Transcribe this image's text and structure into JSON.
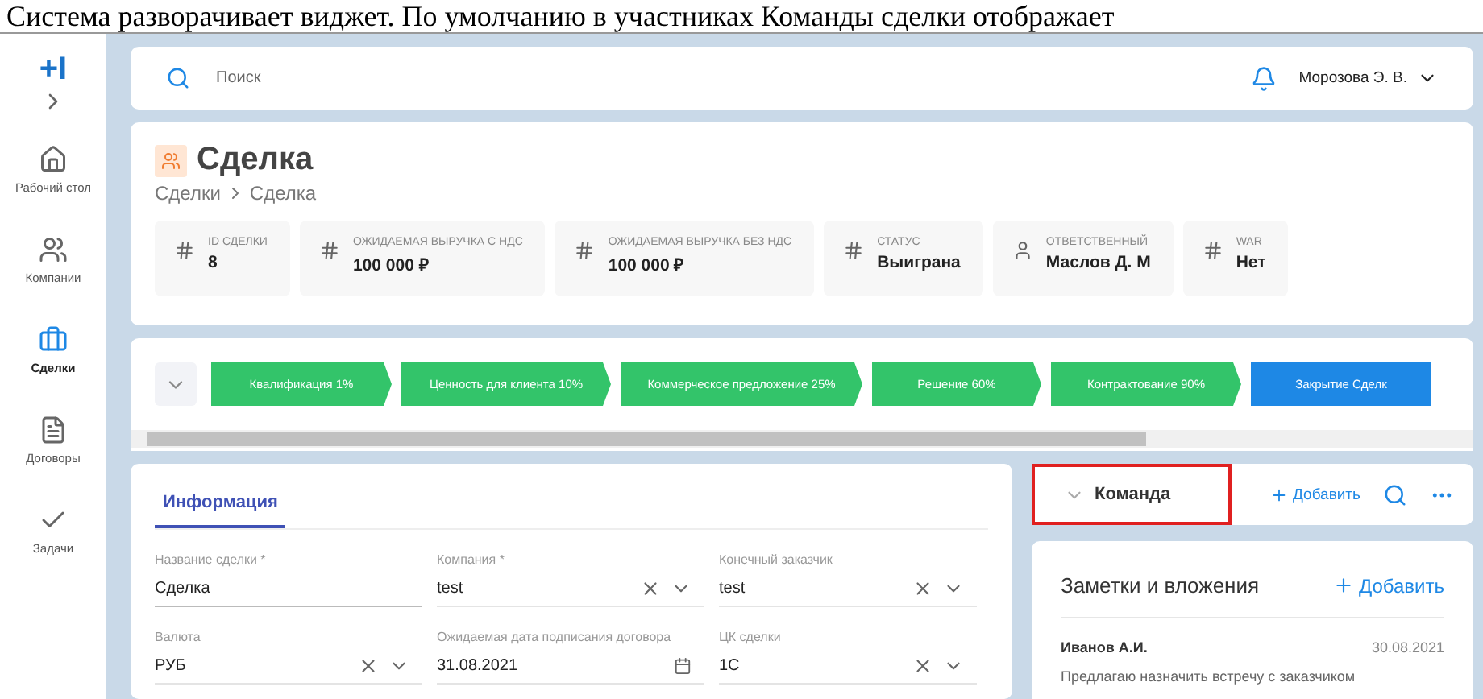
{
  "caption": "Система разворачивает виджет. По умолчанию в участниках Команды сделки отображает",
  "logo": "+I",
  "sidebar": {
    "items": [
      {
        "label": "Рабочий стол",
        "selected": false
      },
      {
        "label": "Компании",
        "selected": false
      },
      {
        "label": "Сделки",
        "selected": true
      },
      {
        "label": "Договоры",
        "selected": false
      },
      {
        "label": "Задачи",
        "selected": false
      }
    ]
  },
  "search": {
    "placeholder": "Поиск"
  },
  "user": "Морозова Э. В.",
  "deal": {
    "title": "Сделка",
    "breadcrumbs": [
      "Сделки",
      "Сделка"
    ],
    "stats": [
      {
        "kind": "number",
        "label": "ID СДЕЛКИ",
        "value": "8"
      },
      {
        "kind": "number",
        "label": "ОЖИДАЕМАЯ ВЫРУЧКА С НДС",
        "value": "100 000 ₽"
      },
      {
        "kind": "number",
        "label": "ОЖИДАЕМАЯ ВЫРУЧКА БЕЗ НДС",
        "value": "100 000 ₽"
      },
      {
        "kind": "number",
        "label": "СТАТУС",
        "value": "Выиграна"
      },
      {
        "kind": "person",
        "label": "ОТВЕТСТВЕННЫЙ",
        "value": "Маслов Д. М"
      },
      {
        "kind": "number",
        "label": "WAR",
        "value": "Нет"
      }
    ]
  },
  "stages": [
    {
      "label": "Квалификация 1%",
      "selected": false
    },
    {
      "label": "Ценность для клиента 10%",
      "selected": false
    },
    {
      "label": "Коммерческое предложение 25%",
      "selected": false
    },
    {
      "label": "Решение 60%",
      "selected": false
    },
    {
      "label": "Контрактование 90%",
      "selected": false
    },
    {
      "label": "Закрытие Сделк",
      "selected": true
    }
  ],
  "info": {
    "tab": "Информация",
    "fields": [
      {
        "kind": "text",
        "label": "Название сделки *",
        "value": "Сделка"
      },
      {
        "kind": "select",
        "label": "Компания *",
        "value": "test"
      },
      {
        "kind": "select",
        "label": "Конечный заказчик",
        "value": "test"
      },
      {
        "kind": "select",
        "label": "Валюта",
        "value": "РУБ"
      },
      {
        "kind": "date",
        "label": "Ожидаемая дата подписания договора",
        "value": "31.08.2021"
      },
      {
        "kind": "select",
        "label": "ЦК сделки",
        "value": "1С"
      }
    ]
  },
  "team": {
    "title": "Команда",
    "expanded": false,
    "highlighted": true,
    "add": "Добавить"
  },
  "notes": {
    "title": "Заметки и вложения",
    "add": "Добавить",
    "items": [
      {
        "author": "Иванов А.И.",
        "date": "30.08.2021",
        "text": "Предлагаю назначить встречу с заказчиком"
      }
    ]
  }
}
